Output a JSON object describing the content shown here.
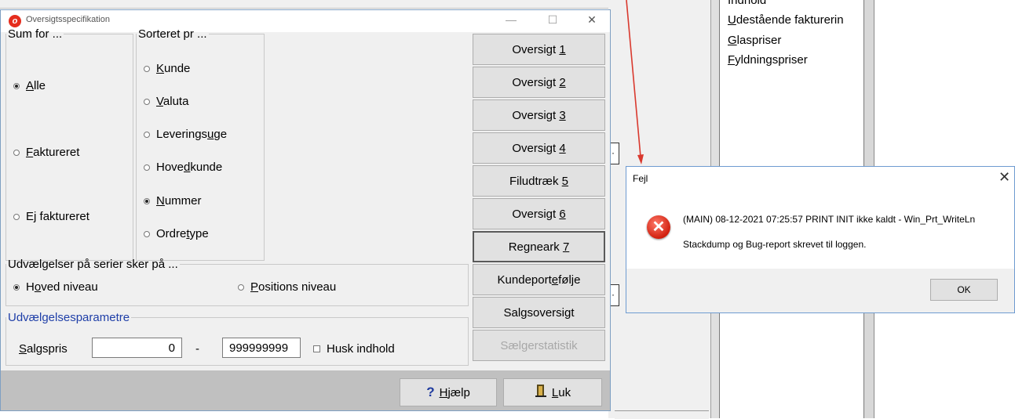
{
  "background_app": {
    "list_items": [
      "Indhold",
      "Udestående fakturerin",
      "Glaspriser",
      "Fyldningspriser"
    ]
  },
  "dialog": {
    "title": "Oversigtsspecifikation",
    "sum_for": {
      "legend": "Sum for ...",
      "options": [
        "Alle",
        "Faktureret",
        "Ej faktureret"
      ],
      "selected": "Alle"
    },
    "sorteret": {
      "legend": "Sorteret pr ...",
      "options": [
        "Kunde",
        "Valuta",
        "Leveringsuge",
        "Hovedkunde",
        "Nummer",
        "Ordretype"
      ],
      "selected": "Nummer"
    },
    "udvaelgelser": {
      "legend": "Udvælgelser på serier sker på ...",
      "options": [
        "Hoved niveau",
        "Positions niveau"
      ],
      "selected": "Hoved niveau"
    },
    "parametre": {
      "legend": "Udvælgelsesparametre",
      "salgspris_label": "Salgspris",
      "from_value": "0",
      "separator": "-",
      "to_value": "999999999",
      "husk_label": "Husk indhold"
    },
    "buttons": [
      "Oversigt 1",
      "Oversigt 2",
      "Oversigt 3",
      "Oversigt 4",
      "Filudtræk 5",
      "Oversigt 6",
      "Regneark 7",
      "Kundeportefølje",
      "Salgsoversigt",
      "Sælgerstatistik"
    ],
    "help_label": "Hjælp",
    "close_label": "Luk"
  },
  "error_dialog": {
    "title": "Fejl",
    "message_line1": "(MAIN) 08-12-2021 07:25:57 PRINT INIT ikke kaldt - Win_Prt_WriteLn",
    "message_line2": "Stackdump og Bug-report skrevet til loggen.",
    "ok_label": "OK"
  },
  "colors": {
    "accent_red": "#e52d1d",
    "legend_blue": "#1f3fa8",
    "annotation_arrow": "#d9392e"
  },
  "icons": [
    "app-icon",
    "minimize-icon",
    "maximize-icon",
    "close-icon",
    "error-icon",
    "help-icon",
    "door-icon"
  ]
}
